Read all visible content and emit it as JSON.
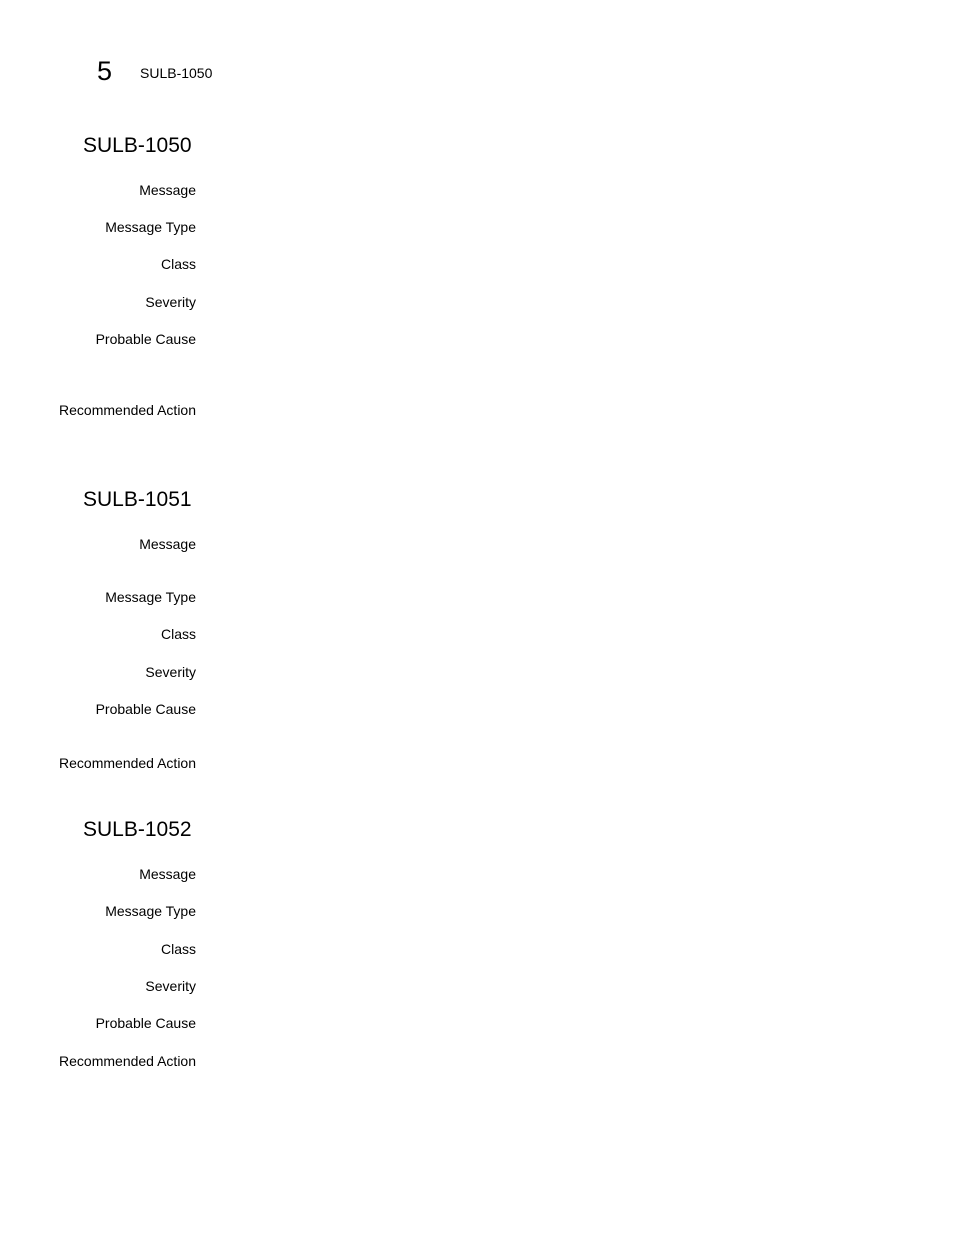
{
  "header": {
    "chapter_number": "5",
    "running_title": "SULB-1050"
  },
  "sections": [
    {
      "id": "SULB-1050",
      "fields": [
        {
          "label": "Message",
          "value": ""
        },
        {
          "label": "Message Type",
          "value": ""
        },
        {
          "label": "Class",
          "value": ""
        },
        {
          "label": "Severity",
          "value": ""
        },
        {
          "label": "Probable Cause",
          "value": ""
        },
        {
          "label": "Recommended Action",
          "value": ""
        }
      ]
    },
    {
      "id": "SULB-1051",
      "fields": [
        {
          "label": "Message",
          "value": ""
        },
        {
          "label": "Message Type",
          "value": ""
        },
        {
          "label": "Class",
          "value": ""
        },
        {
          "label": "Severity",
          "value": ""
        },
        {
          "label": "Probable Cause",
          "value": ""
        },
        {
          "label": "Recommended Action",
          "value": ""
        }
      ]
    },
    {
      "id": "SULB-1052",
      "fields": [
        {
          "label": "Message",
          "value": ""
        },
        {
          "label": "Message Type",
          "value": ""
        },
        {
          "label": "Class",
          "value": ""
        },
        {
          "label": "Severity",
          "value": ""
        },
        {
          "label": "Probable Cause",
          "value": ""
        },
        {
          "label": "Recommended Action",
          "value": ""
        }
      ]
    }
  ]
}
